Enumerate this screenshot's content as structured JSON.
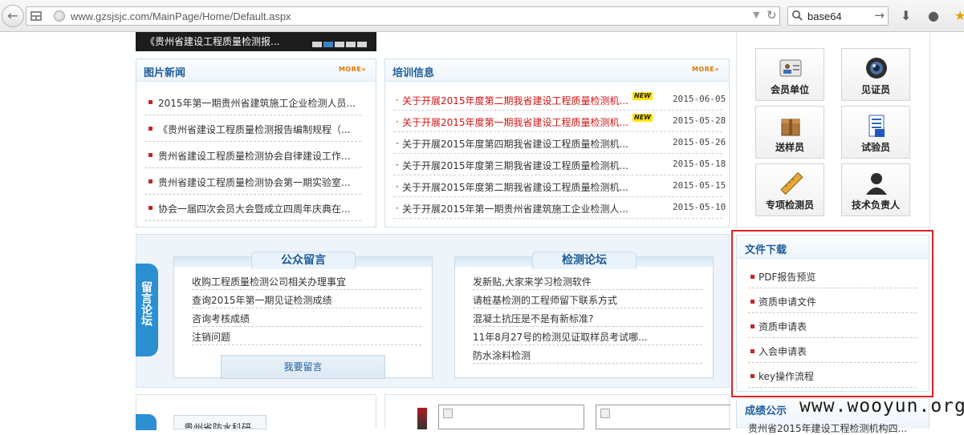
{
  "browser": {
    "url": "www.gzsjsjc.com/MainPage/Home/Default.aspx",
    "search_query": "base64"
  },
  "slider": {
    "caption": "《贵州省建设工程质量检测报..."
  },
  "picture_news": {
    "title": "图片新闻",
    "more": "MORE»",
    "items": [
      "2015年第一期贵州省建筑施工企业检测人员...",
      "《贵州省建设工程质量检测报告编制规程（...",
      "贵州省建设工程质量检测协会自律建设工作...",
      "贵州省建设工程质量检测协会第一期实验室...",
      "协会一届四次会员大会暨成立四周年庆典在..."
    ]
  },
  "training": {
    "title": "培训信息",
    "more": "MORE»",
    "new_badge": "NEW",
    "items": [
      {
        "text": "关于开展2015年度第二期我省建设工程质量检测机...",
        "date": "2015-06-05",
        "highlight": true
      },
      {
        "text": "关于开展2015年度第一期我省建设工程质量检测机...",
        "date": "2015-05-28",
        "highlight": true
      },
      {
        "text": "关于开展2015年度第四期我省建设工程质量检测机...",
        "date": "2015-05-26",
        "highlight": false
      },
      {
        "text": "关于开展2015年度第三期我省建设工程质量检测机...",
        "date": "2015-05-18",
        "highlight": false
      },
      {
        "text": "关于开展2015年度第二期我省建设工程质量检测机...",
        "date": "2015-05-15",
        "highlight": false
      },
      {
        "text": "关于开展2015年第一期贵州省建筑施工企业检测人...",
        "date": "2015-05-10",
        "highlight": false
      }
    ]
  },
  "message_area": {
    "side_label": "留言论坛",
    "public": {
      "title": "公众留言",
      "items": [
        "收购工程质量检测公司相关办理事宜",
        "查询2015年第一期见证检测成绩",
        "咨询考核成绩",
        "注销问题"
      ],
      "button": "我要留言"
    },
    "forum": {
      "title": "检测论坛",
      "items": [
        "发新贴,大家来学习检测软件",
        "请桩基检测的工程师留下联系方式",
        "混凝土抗压是不是有新标准?",
        "11年8月27号的检测见证取样员考试哪...",
        "防水涂料检测"
      ]
    }
  },
  "roles": [
    {
      "label": "会员单位",
      "icon": "member-card-icon"
    },
    {
      "label": "见证员",
      "icon": "camera-lens-icon"
    },
    {
      "label": "送样员",
      "icon": "package-box-icon"
    },
    {
      "label": "试验员",
      "icon": "document-phone-icon"
    },
    {
      "label": "专项检测员",
      "icon": "ruler-icon"
    },
    {
      "label": "技术负责人",
      "icon": "person-icon"
    }
  ],
  "downloads": {
    "title": "文件下载",
    "items": [
      "PDF报告预览",
      "资质申请文件",
      "资质申请表",
      "入会申请表",
      "key操作流程"
    ]
  },
  "results_snippet": {
    "title": "成绩公示",
    "line": "贵州省2015年建设工程检测机构四..."
  },
  "lower_snippet": {
    "text": "贵州省防水科研..."
  },
  "watermark": "www.wooyun.org"
}
